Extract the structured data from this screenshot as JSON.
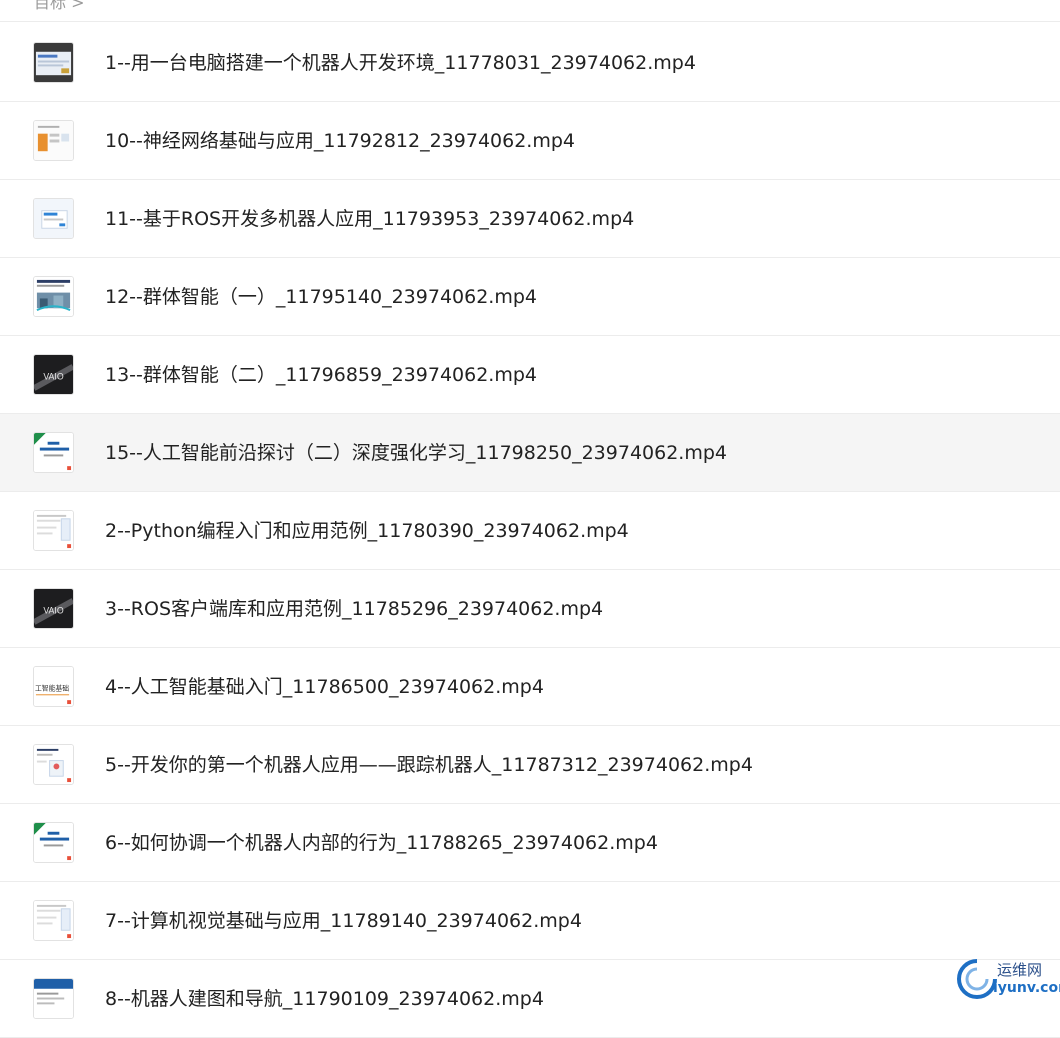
{
  "breadcrumb": {
    "text": "目标 >"
  },
  "files": [
    {
      "name": "1--用一台电脑搭建一个机器人开发环境_11778031_23974062.mp4",
      "thumb": "screen"
    },
    {
      "name": "10--神经网络基础与应用_11792812_23974062.mp4",
      "thumb": "slide-orange"
    },
    {
      "name": "11--基于ROS开发多机器人应用_11793953_23974062.mp4",
      "thumb": "slide-blue-dialog"
    },
    {
      "name": "12--群体智能（一）_11795140_23974062.mp4",
      "thumb": "slide-photo"
    },
    {
      "name": "13--群体智能（二）_11796859_23974062.mp4",
      "thumb": "vaio"
    },
    {
      "name": "15--人工智能前沿探讨（二）深度强化学习_11798250_23974062.mp4",
      "thumb": "slide-title-green"
    },
    {
      "name": "2--Python编程入门和应用范例_11780390_23974062.mp4",
      "thumb": "slide-doc"
    },
    {
      "name": "3--ROS客户端库和应用范例_11785296_23974062.mp4",
      "thumb": "vaio"
    },
    {
      "name": "4--人工智能基础入门_11786500_23974062.mp4",
      "thumb": "slide-text"
    },
    {
      "name": "5--开发你的第一个机器人应用——跟踪机器人_11787312_23974062.mp4",
      "thumb": "slide-figure"
    },
    {
      "name": "6--如何协调一个机器人内部的行为_11788265_23974062.mp4",
      "thumb": "slide-title-green"
    },
    {
      "name": "7--计算机视觉基础与应用_11789140_23974062.mp4",
      "thumb": "slide-doc"
    },
    {
      "name": "8--机器人建图和导航_11790109_23974062.mp4",
      "thumb": "slide-blue-header"
    }
  ],
  "hovered_index": 5,
  "thumb_labels": {
    "vaio": "VAIO",
    "slide_text": "工智能基础"
  },
  "watermark": {
    "cn": "运维网",
    "en": "iyunv.com"
  }
}
